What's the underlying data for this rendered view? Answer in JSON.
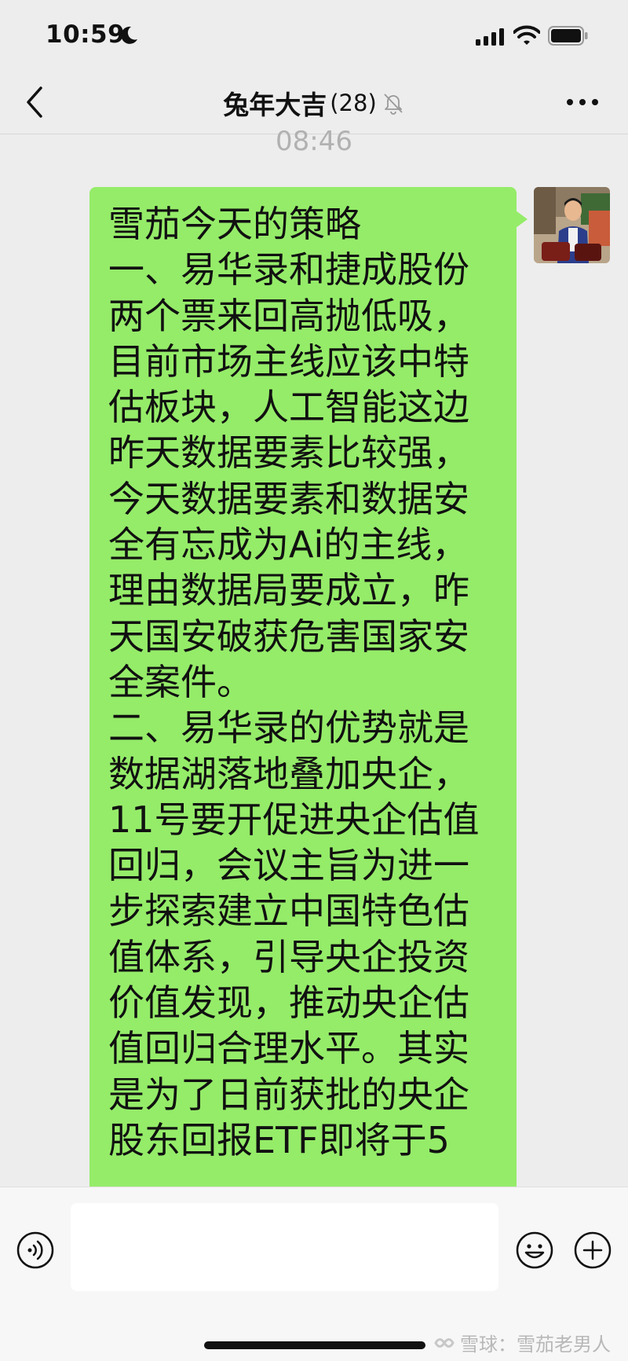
{
  "status_bar": {
    "time": "10:59"
  },
  "nav": {
    "title": "兔年大吉",
    "member_count": "(28)"
  },
  "chat": {
    "timestamp": "08:46",
    "message": "雪茄今天的策略\n一、易华录和捷成股份\n两个票来回高抛低吸，\n目前市场主线应该中特\n估板块，人工智能这边\n昨天数据要素比较强，\n今天数据要素和数据安\n全有忘成为Ai的主线，\n理由数据局要成立，昨\n天国安破获危害国家安\n全案件。\n二、易华录的优势就是\n数据湖落地叠加央企，\n11号要开促进央企估值\n回归，会议主旨为进一\n步探索建立中国特色估\n值体系，引导央企投资\n价值发现，推动央企估\n值回归合理水平。其实\n是为了日前获批的央企\n股东回报ETF即将于5"
  },
  "watermark": "雪球：雪茄老男人",
  "colors": {
    "bubble": "#95ec69",
    "background": "#ededed",
    "input_bar": "#f7f7f7"
  }
}
